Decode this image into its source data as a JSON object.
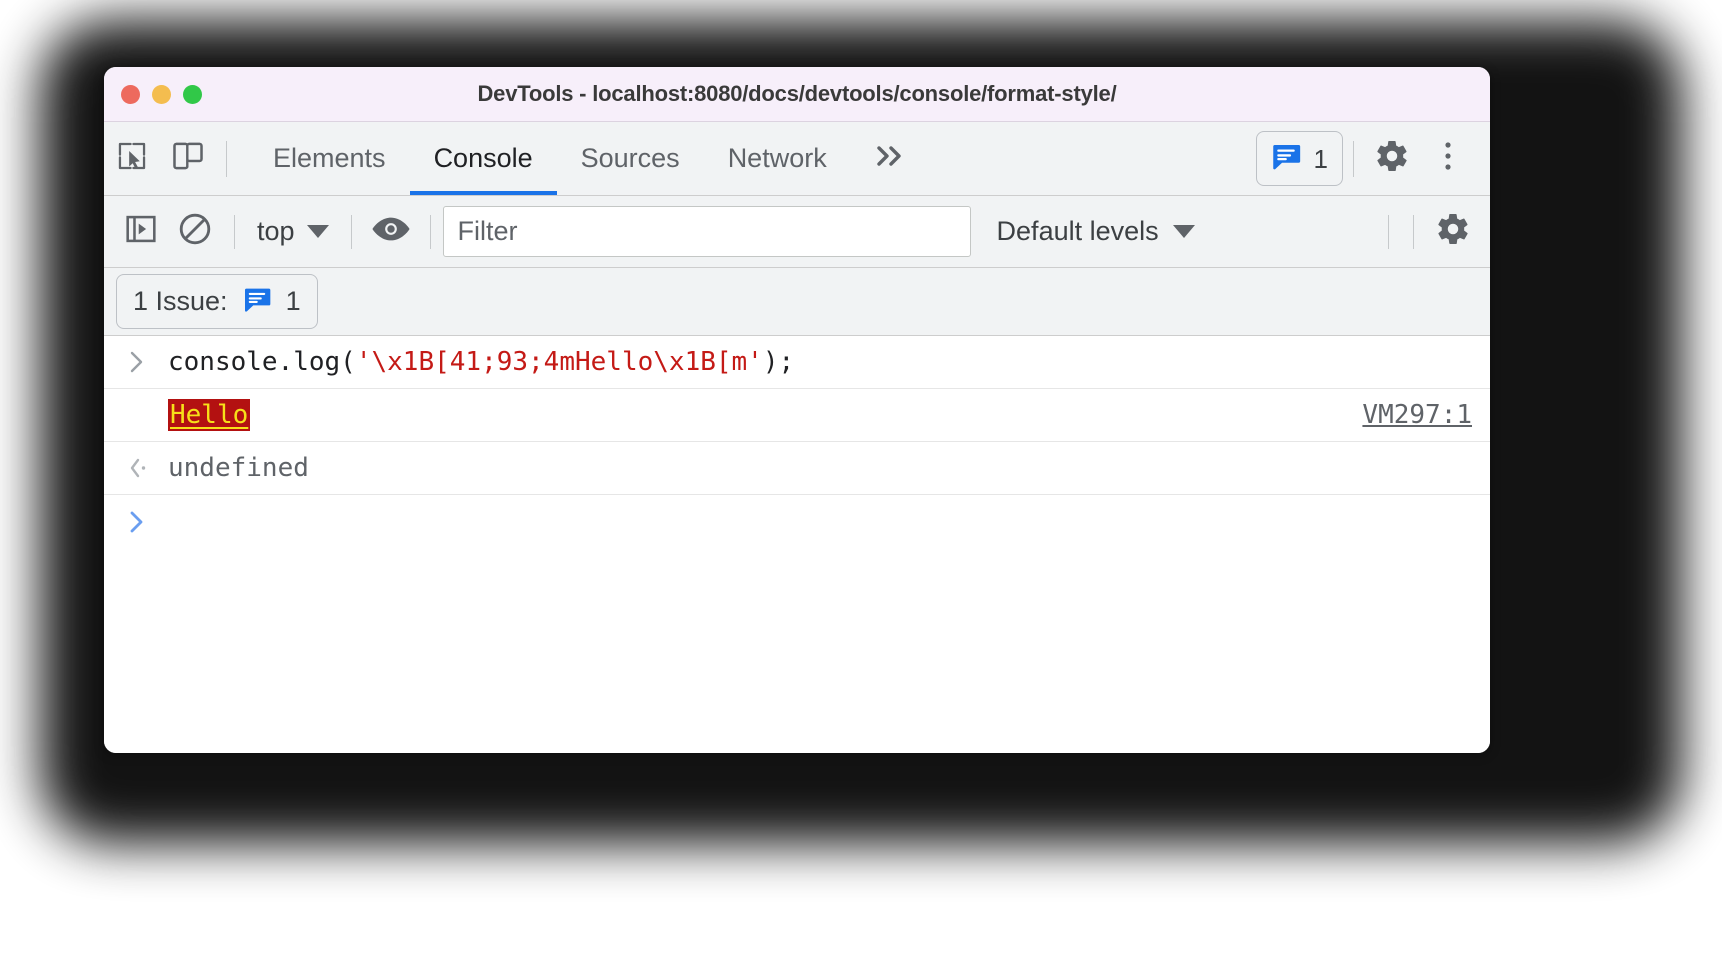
{
  "window": {
    "title": "DevTools - localhost:8080/docs/devtools/console/format-style/",
    "traffic_lights": {
      "close": "close-window",
      "minimize": "minimize-window",
      "maximize": "maximize-window"
    }
  },
  "tabstrip": {
    "inspect_icon": "inspect-element-icon",
    "device_toolbar_icon": "device-toolbar-icon",
    "tabs": [
      {
        "label": "Elements",
        "selected": false
      },
      {
        "label": "Console",
        "selected": true
      },
      {
        "label": "Sources",
        "selected": false
      },
      {
        "label": "Network",
        "selected": false
      }
    ],
    "more_tabs_label": "»",
    "issues_chip": {
      "icon": "issues-bubble-icon",
      "count": "1"
    },
    "settings_icon": "gear-icon",
    "more_options_icon": "kebab-menu-icon"
  },
  "console_toolbar": {
    "sidebar_toggle_icon": "console-sidebar-icon",
    "clear_console_icon": "clear-console-icon",
    "context": {
      "value": "top",
      "caret": "chevron-down-icon"
    },
    "live_expression_icon": "eye-icon",
    "filter": {
      "placeholder": "Filter",
      "value": ""
    },
    "levels": {
      "value": "Default levels",
      "caret": "chevron-down-icon"
    },
    "settings_icon": "console-settings-gear-icon"
  },
  "issues_bar": {
    "label": "1 Issue:",
    "icon": "issues-bubble-icon",
    "count": "1"
  },
  "console": {
    "rows": [
      {
        "type": "input",
        "gutter": ">",
        "code_prefix": "console.log(",
        "code_string": "'\\x1B[41;93;4mHello\\x1B[m'",
        "code_suffix": ");"
      },
      {
        "type": "output",
        "gutter": "",
        "text": "Hello",
        "source_link": "VM297:1",
        "style": {
          "background": "#b31111",
          "color": "#f7e019",
          "underline": true
        }
      },
      {
        "type": "result",
        "gutter": "‹·",
        "text": "undefined"
      }
    ],
    "prompt": ">"
  },
  "colors": {
    "accent": "#1a73e8",
    "titlebar_bg": "#f7effa",
    "toolbar_bg": "#f1f3f4",
    "string_literal": "#c41a16",
    "ansi_bg": "#b31111",
    "ansi_fg": "#f7e019"
  }
}
